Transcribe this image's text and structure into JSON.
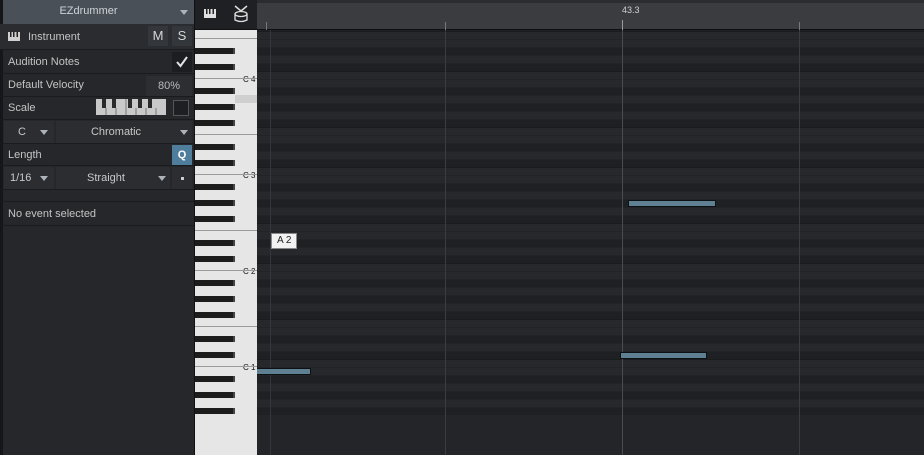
{
  "inspector": {
    "instrument_name": "EZdrummer",
    "instrument_label": "Instrument",
    "mute_label": "M",
    "solo_label": "S",
    "audition_notes_label": "Audition Notes",
    "audition_notes_checked": true,
    "default_velocity_label": "Default Velocity",
    "default_velocity_value": "80%",
    "scale_label": "Scale",
    "scale_root": "C",
    "scale_type": "Chromatic",
    "length_label": "Length",
    "quantize_label": "Q",
    "length_value": "1/16",
    "length_mode": "Straight",
    "event_status": "No event selected"
  },
  "ruler": {
    "position_label": "43.3"
  },
  "keyboard": {
    "octave_labels": [
      "C 4",
      "C 3",
      "C 2",
      "C 1"
    ],
    "highlighted_key": "A 2"
  },
  "tooltip": {
    "text": "A 2"
  },
  "colors": {
    "note_fill": "#5f7f93",
    "accent_blue": "#4f7d9c",
    "panel_bg": "#25272a",
    "grid_bg": "#242528"
  }
}
